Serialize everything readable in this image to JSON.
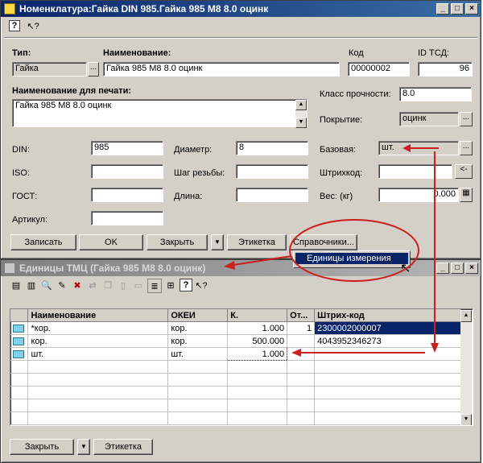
{
  "main_window": {
    "title": "Номенклатура:Гайка DIN 985.Гайка 985 М8 8.0 оцинк",
    "fields": {
      "type_label": "Тип:",
      "type_value": "Гайка",
      "name_label": "Наименование:",
      "name_value": "Гайка 985 М8 8.0 оцинк",
      "code_label": "Код",
      "code_value": "00000002",
      "id_label": "ID ТСД:",
      "id_value": "96",
      "print_name_label": "Наименование для печати:",
      "print_name_value": "Гайка 985 М8 8.0 оцинк",
      "class_label": "Класс прочности:",
      "class_value": "8.0",
      "coating_label": "Покрытие:",
      "coating_value": "оцинк",
      "din_label": "DIN:",
      "din_value": "985",
      "diameter_label": "Диаметр:",
      "diameter_value": "8",
      "base_label": "Базовая:",
      "base_value": "шт.",
      "iso_label": "ISO:",
      "iso_value": "",
      "pitch_label": "Шаг резьбы:",
      "pitch_value": "",
      "barcode_label": "Штрихкод:",
      "barcode_value": "",
      "gost_label": "ГОСТ:",
      "gost_value": "",
      "length_label": "Длина:",
      "length_value": "",
      "weight_label": "Вес: (кг)",
      "weight_value": "0.000",
      "article_label": "Артикул:",
      "article_value": ""
    },
    "buttons": {
      "save": "Записать",
      "ok": "OK",
      "close": "Закрыть",
      "label": "Этикетка",
      "directories": "Справочники..."
    },
    "menu_item": "Единицы измерения"
  },
  "units_window": {
    "title": "Единицы ТМЦ (Гайка 985 М8 8.0 оцинк)",
    "columns": [
      "Наименование",
      "ОКЕИ",
      "К.",
      "От...",
      "Штрих-код"
    ],
    "rows": [
      {
        "name": "*кор.",
        "okei": "кор.",
        "k": "1.000",
        "ot": "1",
        "barcode": "2300002000007"
      },
      {
        "name": "кор.",
        "okei": "кор.",
        "k": "500.000",
        "ot": "",
        "barcode": "4043952346273"
      },
      {
        "name": "шт.",
        "okei": "шт.",
        "k": "1.000",
        "ot": "",
        "barcode": ""
      }
    ],
    "buttons": {
      "close": "Закрыть",
      "label": "Этикетка"
    }
  },
  "colors": {
    "selection": "#0a246a",
    "annotation": "#cc1f1f",
    "window_bg": "#d4d0c8"
  }
}
